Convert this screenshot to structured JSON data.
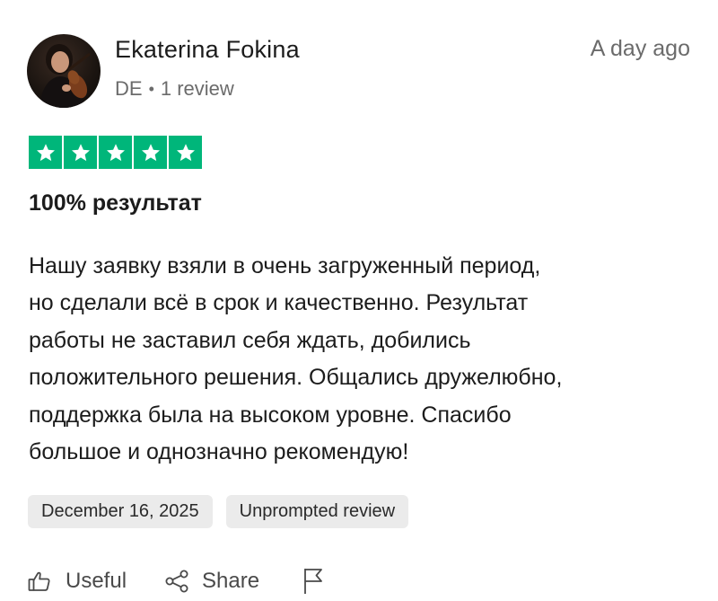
{
  "reviewer": {
    "name": "Ekaterina Fokina",
    "country": "DE",
    "separator": "•",
    "review_count": "1 review"
  },
  "time_ago": "A day ago",
  "rating": {
    "stars": 5,
    "max": 5,
    "color": "#00b67a"
  },
  "review": {
    "title": "100% результат",
    "body_lines": [
      "Нашу заявку взяли в очень загруженный период,",
      "но сделали всё в срок и качественно. Результат",
      "работы не заставил себя ждать, добились",
      "положительного решения. Общались дружелюбно,",
      "поддержка была на высоком уровне. Спасибо",
      "большое и однозначно рекомендую!"
    ]
  },
  "tags": {
    "date": "December 16, 2025",
    "label": "Unprompted review"
  },
  "actions": {
    "useful_label": "Useful",
    "share_label": "Share",
    "useful_icon": "thumbs-up-icon",
    "share_icon": "share-icon",
    "report_icon": "flag-icon"
  }
}
